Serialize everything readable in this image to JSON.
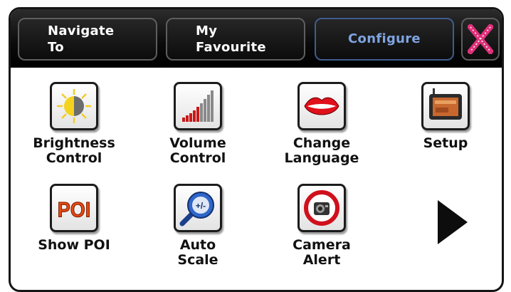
{
  "tabs": {
    "navigate_to": [
      "Navigate",
      "To"
    ],
    "my_favourite": [
      "My",
      "Favourite"
    ],
    "configure": "Configure"
  },
  "close_icon": "close-x-icon",
  "colors": {
    "active_tab_text": "#7fa4e0",
    "close_x": "#e0307a",
    "topbar": "#111111"
  },
  "menu": [
    {
      "label": "Brightness\nControl",
      "icon": "brightness-icon"
    },
    {
      "label": "Volume\nControl",
      "icon": "volume-bars-icon"
    },
    {
      "label": "Change\nLanguage",
      "icon": "lips-icon"
    },
    {
      "label": "Setup",
      "icon": "device-setup-icon"
    },
    {
      "label": "Show POI",
      "icon": "poi-icon",
      "icon_text": "POI"
    },
    {
      "label": "Auto\nScale",
      "icon": "zoom-scale-icon",
      "icon_text": "+/-"
    },
    {
      "label": "Camera\nAlert",
      "icon": "camera-alert-icon"
    }
  ],
  "next_page_icon": "play-right-arrow-icon"
}
